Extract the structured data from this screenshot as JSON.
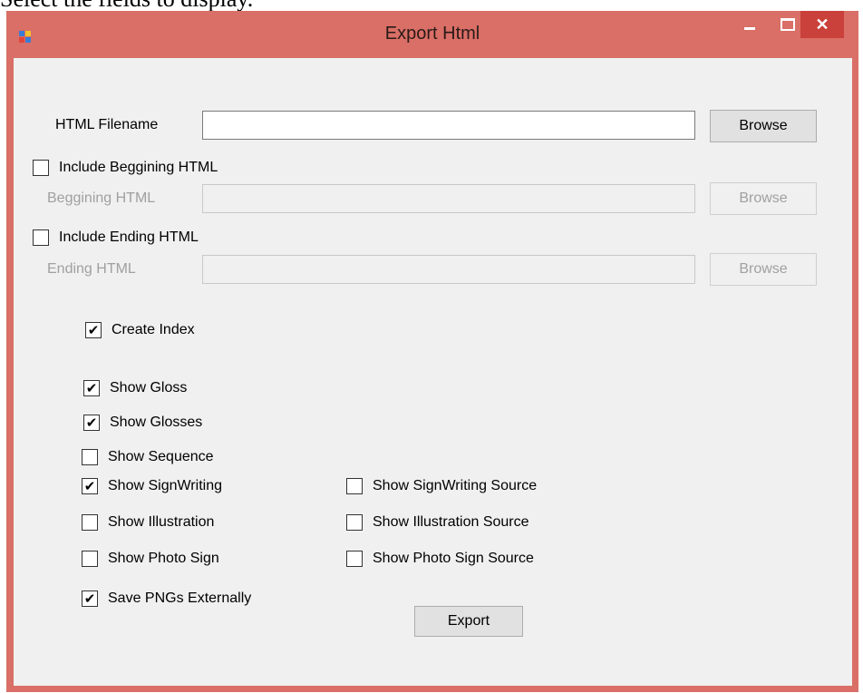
{
  "caption": "Select the fields to display.",
  "window": {
    "title": "Export Html",
    "controls": {
      "minimize": "–",
      "maximize": "□",
      "close": "✕"
    }
  },
  "html_filename": {
    "label": "HTML Filename",
    "value": "",
    "browse": "Browse"
  },
  "beginning": {
    "checkbox_label": "Include Beggining HTML",
    "checked": false,
    "label": "Beggining HTML",
    "value": "",
    "browse": "Browse"
  },
  "ending": {
    "checkbox_label": "Include Ending HTML",
    "checked": false,
    "label": "Ending HTML",
    "value": "",
    "browse": "Browse"
  },
  "options": {
    "create_index": {
      "label": "Create Index",
      "checked": true
    },
    "show_gloss": {
      "label": "Show Gloss",
      "checked": true
    },
    "show_glosses": {
      "label": "Show Glosses",
      "checked": true
    },
    "show_sequence": {
      "label": "Show Sequence",
      "checked": false
    },
    "show_signwriting": {
      "label": "Show SignWriting",
      "checked": true
    },
    "show_signwriting_source": {
      "label": "Show SignWriting Source",
      "checked": false
    },
    "show_illustration": {
      "label": "Show Illustration",
      "checked": false
    },
    "show_illustration_source": {
      "label": "Show Illustration Source",
      "checked": false
    },
    "show_photo_sign": {
      "label": "Show Photo Sign",
      "checked": false
    },
    "show_photo_sign_source": {
      "label": "Show Photo Sign Source",
      "checked": false
    },
    "save_pngs_externally": {
      "label": "Save PNGs Externally",
      "checked": true
    }
  },
  "export_button": "Export",
  "colors": {
    "title_bar": "#d96f66",
    "close_button": "#c9413a",
    "client_bg": "#f0f0f0",
    "disabled_text": "#a0a0a0"
  },
  "icons": {
    "app": "app-icon",
    "check": "check-icon"
  }
}
